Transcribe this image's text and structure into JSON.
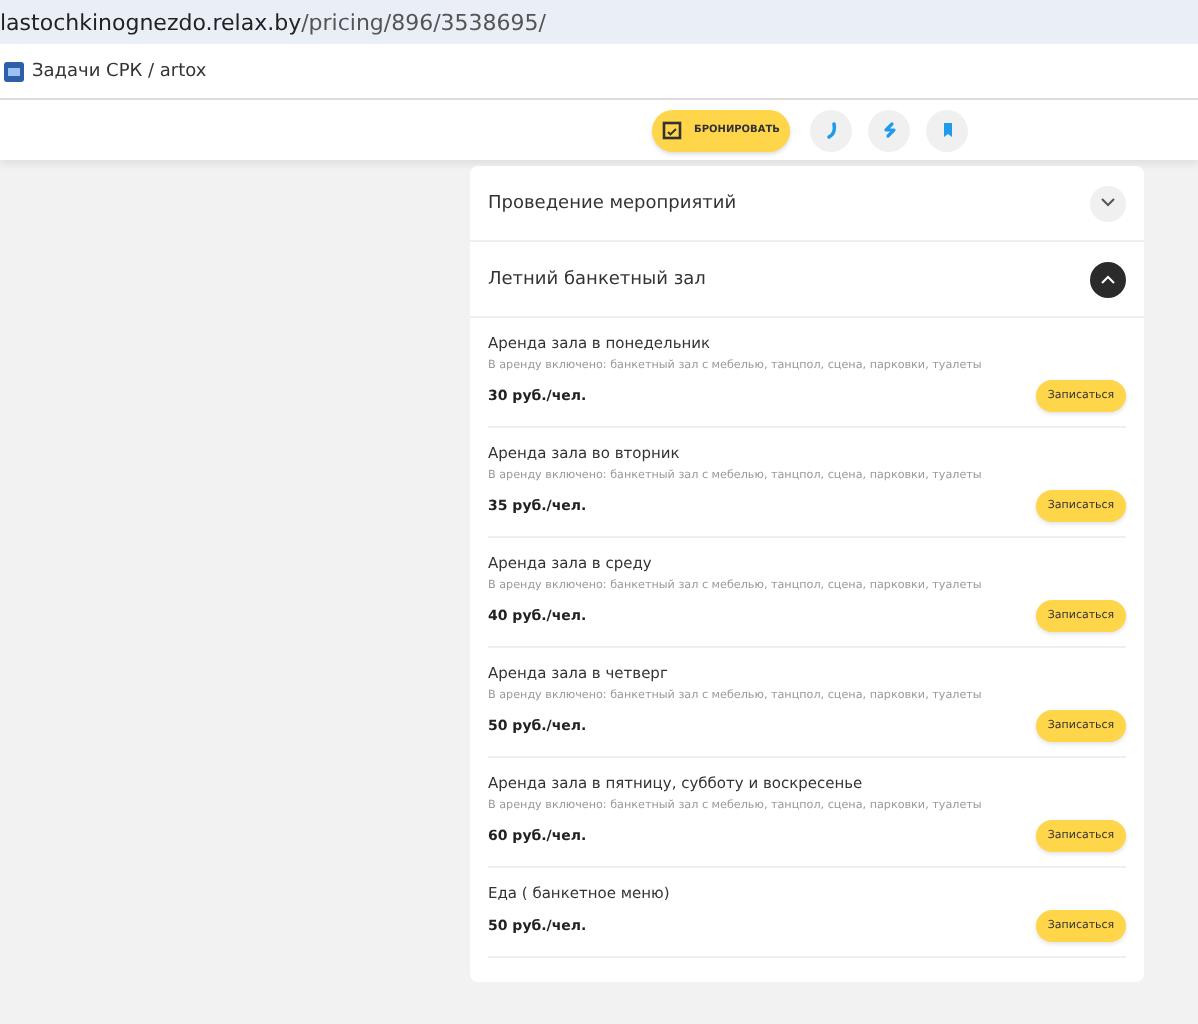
{
  "address_bar": {
    "url_host": "lastochkinognezdo.relax.by",
    "url_path": "/pricing/896/3538695/"
  },
  "bookmarks": [
    {
      "label": "Задачи СРК / artox"
    }
  ],
  "toolbar": {
    "book_button": "БРОНИРОВАТЬ"
  },
  "sections": [
    {
      "title": "Проведение мероприятий",
      "expanded": false
    },
    {
      "title": "Летний банкетный зал",
      "expanded": true,
      "items": [
        {
          "title": "Аренда зала в понедельник",
          "description": "В аренду включено: банкетный зал с мебелью, танцпол, сцена, парковки, туалеты",
          "price": "30 руб./чел.",
          "button": "Записаться"
        },
        {
          "title": "Аренда зала во вторник",
          "description": "В аренду включено: банкетный зал с мебелью, танцпол, сцена, парковки, туалеты",
          "price": "35 руб./чел.",
          "button": "Записаться"
        },
        {
          "title": "Аренда зала в среду",
          "description": "В аренду включено: банкетный зал с мебелью, танцпол, сцена, парковки, туалеты",
          "price": "40 руб./чел.",
          "button": "Записаться"
        },
        {
          "title": "Аренда зала в четверг",
          "description": "В аренду включено: банкетный зал с мебелью, танцпол, сцена, парковки, туалеты",
          "price": "50 руб./чел.",
          "button": "Записаться"
        },
        {
          "title": "Аренда зала в пятницу, субботу и воскресенье",
          "description": "В аренду включено: банкетный зал с мебелью, танцпол, сцена, парковки, туалеты",
          "price": "60 руб./чел.",
          "button": "Записаться"
        },
        {
          "title": "Еда ( банкетное меню)",
          "price": "50 руб./чел.",
          "button": "Записаться"
        }
      ]
    }
  ]
}
